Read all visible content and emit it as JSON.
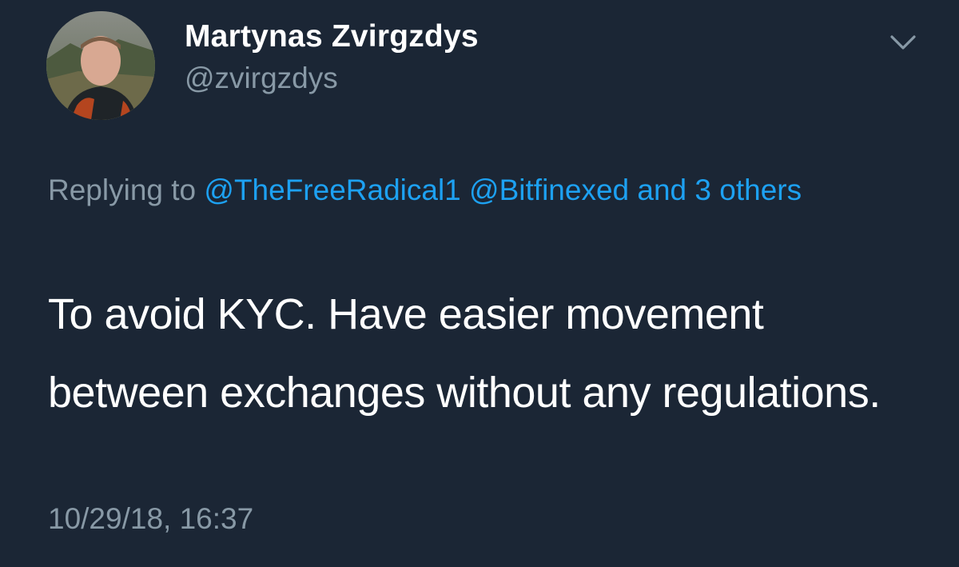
{
  "tweet": {
    "author": {
      "display_name": "Martynas Zvirgzdys",
      "handle": "@zvirgzdys",
      "avatar": "avatar-photo"
    },
    "menu_icon": "chevron-down-icon",
    "reply_context": {
      "prefix": "Replying to",
      "mentions": [
        "@TheFreeRadical1",
        "@Bitfinexed"
      ],
      "others_text": "and 3 others"
    },
    "text": "To avoid KYC. Have easier movement between exchanges without any regulations.",
    "timestamp": "10/29/18, 16:37"
  },
  "colors": {
    "background": "#1b2635",
    "primary_text": "#ffffff",
    "secondary_text": "#8899a6",
    "link": "#1da1f2"
  }
}
